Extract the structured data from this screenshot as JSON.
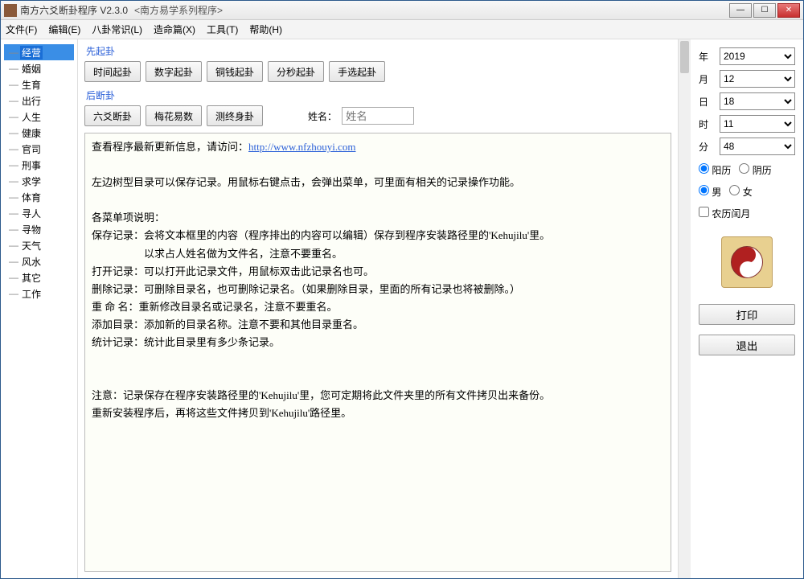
{
  "window": {
    "title": "南方六爻断卦程序 V2.3.0",
    "subtitle": "<南方易学系列程序>"
  },
  "menus": [
    "文件(F)",
    "编辑(E)",
    "八卦常识(L)",
    "造命篇(X)",
    "工具(T)",
    "帮助(H)"
  ],
  "tree": [
    "经营",
    "婚姻",
    "生育",
    "出行",
    "人生",
    "健康",
    "官司",
    "刑事",
    "求学",
    "体育",
    "寻人",
    "寻物",
    "天气",
    "风水",
    "其它",
    "工作"
  ],
  "tree_selected": 0,
  "sections": {
    "pre_label": "先起卦",
    "pre_buttons": [
      "时间起卦",
      "数字起卦",
      "铜钱起卦",
      "分秒起卦",
      "手选起卦"
    ],
    "post_label": "后断卦",
    "post_buttons": [
      "六爻断卦",
      "梅花易数",
      "测终身卦"
    ],
    "name_label": "姓名：",
    "name_placeholder": "姓名"
  },
  "content": {
    "line1": "查看程序最新更新信息，请访问：",
    "url": "http://www.nfzhouyi.com",
    "body": "\n\n左边树型目录可以保存记录。用鼠标右键点击，会弹出菜单，可里面有相关的记录操作功能。\n\n各菜单项说明：\n保存记录：会将文本框里的内容（程序排出的内容可以编辑）保存到程序安装路径里的'Kehujilu'里。\n　　　　　以求占人姓名做为文件名，注意不要重名。\n打开记录：可以打开此记录文件，用鼠标双击此记录名也可。\n删除记录：可删除目录名，也可删除记录名。（如果删除目录，里面的所有记录也将被删除。）\n重 命 名：重新修改目录名或记录名，注意不要重名。\n添加目录：添加新的目录名称。注意不要和其他目录重名。\n统计记录：统计此目录里有多少条记录。\n\n\n注意：记录保存在程序安装路径里的'Kehujilu'里，您可定期将此文件夹里的所有文件拷贝出来备份。\n重新安装程序后，再将这些文件拷贝到'Kehujilu'路径里。"
  },
  "date": {
    "labels": {
      "year": "年",
      "month": "月",
      "day": "日",
      "hour": "时",
      "minute": "分"
    },
    "year": "2019",
    "month": "12",
    "day": "18",
    "hour": "11",
    "minute": "48"
  },
  "options": {
    "solar": "阳历",
    "lunar": "阴历",
    "male": "男",
    "female": "女",
    "leap": "农历闰月"
  },
  "actions": {
    "print": "打印",
    "exit": "退出"
  }
}
